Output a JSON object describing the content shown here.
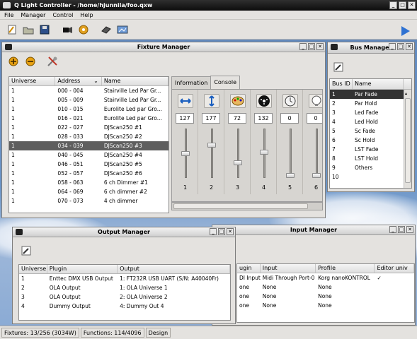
{
  "app": {
    "title": "Q Light Controller - /home/hjunnila/foo.qxw",
    "menu": [
      "File",
      "Manager",
      "Control",
      "Help"
    ]
  },
  "fixture_manager": {
    "title": "Fixture Manager",
    "columns": [
      "Universe",
      "Address",
      "Name"
    ],
    "rows": [
      [
        "1",
        "000 - 004",
        "Stairville Led Par Gr..."
      ],
      [
        "1",
        "005 - 009",
        "Stairville Led Par Gr..."
      ],
      [
        "1",
        "010 - 015",
        "Eurolite Led par Gro..."
      ],
      [
        "1",
        "016 - 021",
        "Eurolite Led par Gro..."
      ],
      [
        "1",
        "022 - 027",
        "DJScan250 #1"
      ],
      [
        "1",
        "028 - 033",
        "DJScan250 #2"
      ],
      [
        "1",
        "034 - 039",
        "DJScan250 #3"
      ],
      [
        "1",
        "040 - 045",
        "DJScan250 #4"
      ],
      [
        "1",
        "046 - 051",
        "DJScan250 #5"
      ],
      [
        "1",
        "052 - 057",
        "DJScan250 #6"
      ],
      [
        "1",
        "058 - 063",
        "6 ch Dimmer #1"
      ],
      [
        "1",
        "064 - 069",
        "6 ch dimmer #2"
      ],
      [
        "1",
        "070 - 073",
        "4 ch dimmer"
      ]
    ],
    "tabs": [
      "Information",
      "Console"
    ],
    "channels": [
      {
        "num": "1",
        "value": "127",
        "level": 0.5,
        "icon": "pan-icon"
      },
      {
        "num": "2",
        "value": "177",
        "level": 0.69,
        "icon": "tilt-icon"
      },
      {
        "num": "3",
        "value": "72",
        "level": 0.28,
        "icon": "color-palette-icon"
      },
      {
        "num": "4",
        "value": "132",
        "level": 0.52,
        "icon": "gobo-icon"
      },
      {
        "num": "5",
        "value": "0",
        "level": 0,
        "icon": "speed-clock-icon"
      },
      {
        "num": "6",
        "value": "0",
        "level": 0,
        "icon": "lamp-icon"
      }
    ]
  },
  "bus_manager": {
    "title": "Bus Manager",
    "columns": [
      "Bus ID",
      "Name"
    ],
    "rows": [
      [
        "1",
        "Par Fade"
      ],
      [
        "2",
        "Par Hold"
      ],
      [
        "3",
        "Led Fade"
      ],
      [
        "4",
        "Led Hold"
      ],
      [
        "5",
        "Sc Fade"
      ],
      [
        "6",
        "Sc Hold"
      ],
      [
        "7",
        "LST Fade"
      ],
      [
        "8",
        "LST Hold"
      ],
      [
        "9",
        "Others"
      ],
      [
        "10",
        ""
      ]
    ]
  },
  "output_manager": {
    "title": "Output Manager",
    "columns": [
      "Universe",
      "Plugin",
      "Output"
    ],
    "rows": [
      [
        "1",
        "Enttec DMX USB Output",
        "1: FT232R USB UART (S/N: A40040Fr)"
      ],
      [
        "2",
        "OLA Output",
        "1: OLA Universe 1"
      ],
      [
        "3",
        "OLA Output",
        "2: OLA Universe 2"
      ],
      [
        "4",
        "Dummy Output",
        "4: Dummy Out 4"
      ]
    ]
  },
  "input_manager": {
    "title": "Input Manager",
    "columns": [
      "ugin",
      "Input",
      "Profile",
      "Editor univ"
    ],
    "rows": [
      [
        "DI Input",
        "Midi Through Port-0",
        "Korg nanoKONTROL",
        "✓"
      ],
      [
        "one",
        "None",
        "None",
        ""
      ],
      [
        "one",
        "None",
        "None",
        ""
      ],
      [
        "one",
        "None",
        "None",
        ""
      ]
    ]
  },
  "status": {
    "fixtures": "Fixtures: 13/256 (3034W)",
    "functions": "Functions: 114/4096",
    "mode": "Design"
  },
  "colors": {
    "selected_row": "#5e5e5e",
    "bus_selected": "#333333",
    "titlebar": "#111111"
  }
}
